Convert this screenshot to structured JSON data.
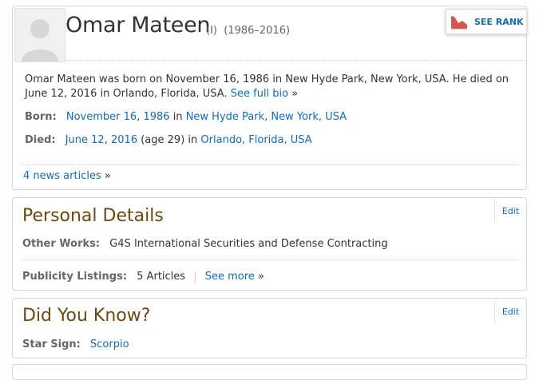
{
  "header": {
    "name": "Omar Mateen",
    "name_suffix": "(I)",
    "lifespan": "(1986–2016)",
    "see_rank_label": "SEE RANK"
  },
  "bio": {
    "text": "Omar Mateen was born on November 16, 1986 in New Hyde Park, New York, USA. He died on June 12, 2016 in Orlando, Florida, USA.",
    "see_full_bio": "See full bio",
    "raquo": "»"
  },
  "born": {
    "label": "Born:",
    "month_day": "November 16",
    "comma": ",",
    "year": "1986",
    "in": "in",
    "place": "New Hyde Park, New York, USA"
  },
  "died": {
    "label": "Died:",
    "month_day": "June 12",
    "comma": ",",
    "year": "2016",
    "age": "(age 29)",
    "in": "in",
    "place": "Orlando, Florida, USA"
  },
  "news": {
    "label": "4 news articles",
    "raquo": "»"
  },
  "personal_details": {
    "title": "Personal Details",
    "edit": "Edit",
    "other_works_label": "Other Works:",
    "other_works_value": "G4S International Securities and Defense Contracting",
    "publicity_label": "Publicity Listings:",
    "publicity_value": "5 Articles",
    "pipe": "|",
    "see_more": "See more",
    "raquo": "»"
  },
  "did_you_know": {
    "title": "Did You Know?",
    "edit": "Edit",
    "star_sign_label": "Star Sign:",
    "star_sign_value": "Scorpio"
  },
  "colors": {
    "link": "#136cb2",
    "section_title": "#6b4a12",
    "rank_icon": "#d9534f"
  }
}
